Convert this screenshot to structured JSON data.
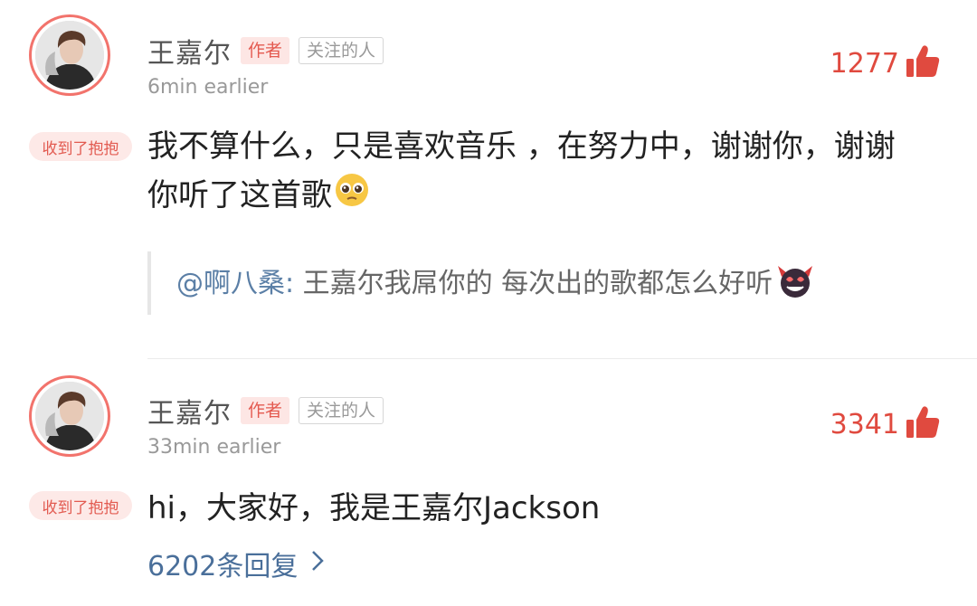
{
  "comments": [
    {
      "user": "王嘉尔",
      "author_tag": "作者",
      "follow_tag": "关注的人",
      "time": "6min earlier",
      "likes": "1277",
      "hug_badge": "收到了抱抱",
      "text_line1": "我不算什么，只是喜欢音乐 ，在努力中，谢谢你，谢谢",
      "text_line2": "你听了这首歌",
      "quote_user": "@啊八桑:",
      "quote_text": " 王嘉尔我屌你的 每次出的歌都怎么好听"
    },
    {
      "user": "王嘉尔",
      "author_tag": "作者",
      "follow_tag": "关注的人",
      "time": "33min earlier",
      "likes": "3341",
      "hug_badge": "收到了抱抱",
      "text_line1": "hi，大家好，我是王嘉尔Jackson",
      "replies": "6202条回复"
    }
  ],
  "icons": {
    "like": "thumbs-up-icon",
    "pleading_emoji": "pleading-face-emoji",
    "devil_emoji": "smiling-devil-emoji",
    "chevron": "chevron-right-icon"
  },
  "colors": {
    "accent": "#e04a3f",
    "link": "#4a6f9a"
  }
}
